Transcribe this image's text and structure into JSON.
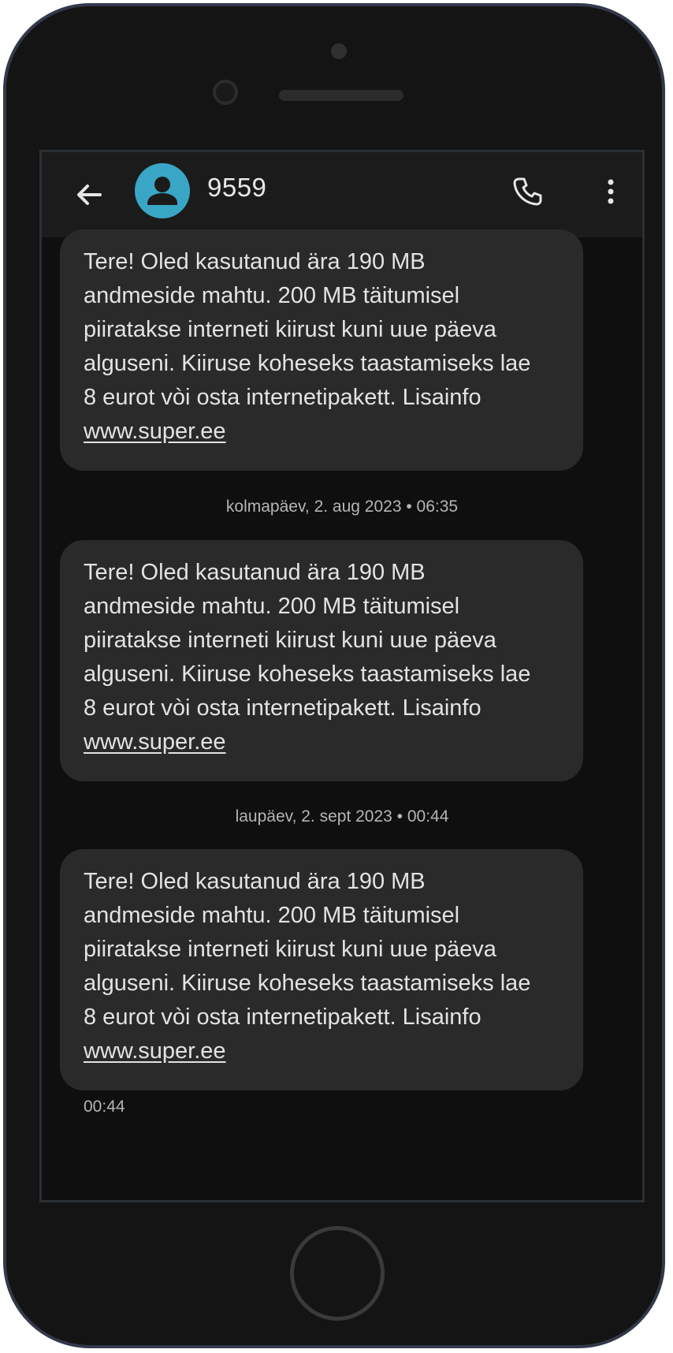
{
  "header": {
    "contact": "9559",
    "back_icon": "arrow-back-icon",
    "avatar_icon": "person-icon",
    "call_icon": "phone-icon",
    "more_icon": "more-vert-icon",
    "avatar_color": "#3aa6c6"
  },
  "messages": [
    {
      "lines": [
        "Tere! Oled kasutanud ära 190 MB",
        "andmeside mahtu. 200 MB täitumisel",
        "piiratakse interneti kiirust kuni uue päeva",
        "alguseni. Kiiruse koheseks taastamiseks lae",
        "8 eurot vòi osta internetipakett. Lisainfo"
      ],
      "link": "www.super.ee"
    },
    {
      "lines": [
        "Tere! Oled kasutanud ära 190 MB",
        "andmeside mahtu. 200 MB täitumisel",
        "piiratakse interneti kiirust kuni uue päeva",
        "alguseni. Kiiruse koheseks taastamiseks lae",
        "8 eurot vòi osta internetipakett. Lisainfo"
      ],
      "link": "www.super.ee"
    },
    {
      "lines": [
        "Tere! Oled kasutanud ära 190 MB",
        "andmeside mahtu. 200 MB täitumisel",
        "piiratakse interneti kiirust kuni uue päeva",
        "alguseni. Kiiruse koheseks taastamiseks lae",
        "8 eurot vòi osta internetipakett. Lisainfo"
      ],
      "link": "www.super.ee",
      "time": "00:44"
    }
  ],
  "dividers": [
    "kolmapäev, 2. aug 2023 • 06:35",
    "laupäev, 2. sept 2023 • 00:44"
  ],
  "colors": {
    "bubble": "#2a2a2a",
    "screen_bg": "#0f0f0f",
    "header_bg": "#1b1b1b",
    "text": "#e3e3e3",
    "meta_text": "#b5b5b5"
  }
}
